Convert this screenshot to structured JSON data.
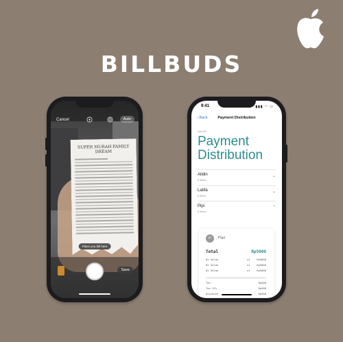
{
  "brand": {
    "title": "BILLBUDS"
  },
  "camera": {
    "cancel_label": "Cancel",
    "auto_label": "Auto",
    "receipt_title": "SUPER MURAH FAMILY DREAM",
    "tip": "Place you bill here",
    "save_label": "Save"
  },
  "app": {
    "status_time": "9:41",
    "back_label": "Back",
    "nav_title": "Payment Distribution",
    "split_label": "Split bill",
    "heading": "Payment Distribution",
    "people": [
      {
        "name": "Alidin",
        "items": "5 items",
        "chevron": "⌄"
      },
      {
        "name": "Latifa",
        "items": "5 items",
        "chevron": "⌄"
      },
      {
        "name": "Pipi",
        "items": "5 items",
        "chevron": "⌃"
      }
    ],
    "card": {
      "avatar_initial": "P",
      "name": "Pipi",
      "total_label": "Total",
      "total_value": "Rp5000",
      "items": [
        {
          "name": "#1 Salan",
          "qty": "x1",
          "price": "Rp5000"
        },
        {
          "name": "#1 Salan",
          "qty": "x1",
          "price": "Rp5000"
        },
        {
          "name": "#1 Salan",
          "qty": "x1",
          "price": "Rp5000"
        }
      ],
      "fees": [
        {
          "name": "Tax",
          "price": "Rp500"
        },
        {
          "name": "Tax 12%",
          "price": "Rp500"
        },
        {
          "name": "Discount",
          "price": "Rp500"
        }
      ]
    }
  },
  "colors": {
    "background": "#8c7f72",
    "accent": "#2c8c8c",
    "link": "#1e7bd8"
  }
}
